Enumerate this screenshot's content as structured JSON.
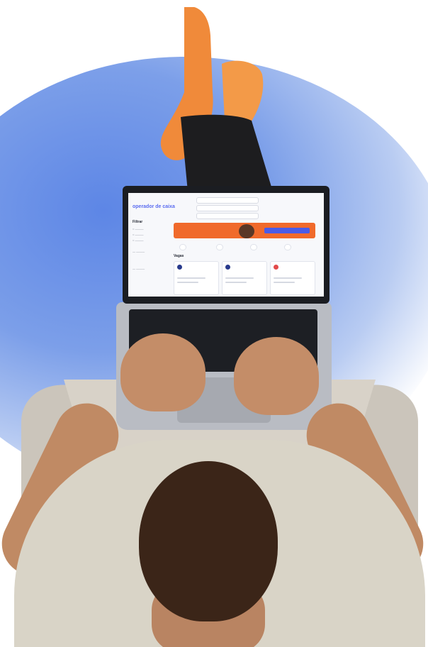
{
  "screen": {
    "title": "operador de caixa",
    "subtitle": "",
    "search_placeholder": "",
    "filter_label": "Filtrar",
    "banner_text": "",
    "banner_button": "",
    "section_label": "",
    "chips": [
      "",
      "",
      "",
      ""
    ],
    "cards": [
      "",
      "",
      ""
    ]
  }
}
